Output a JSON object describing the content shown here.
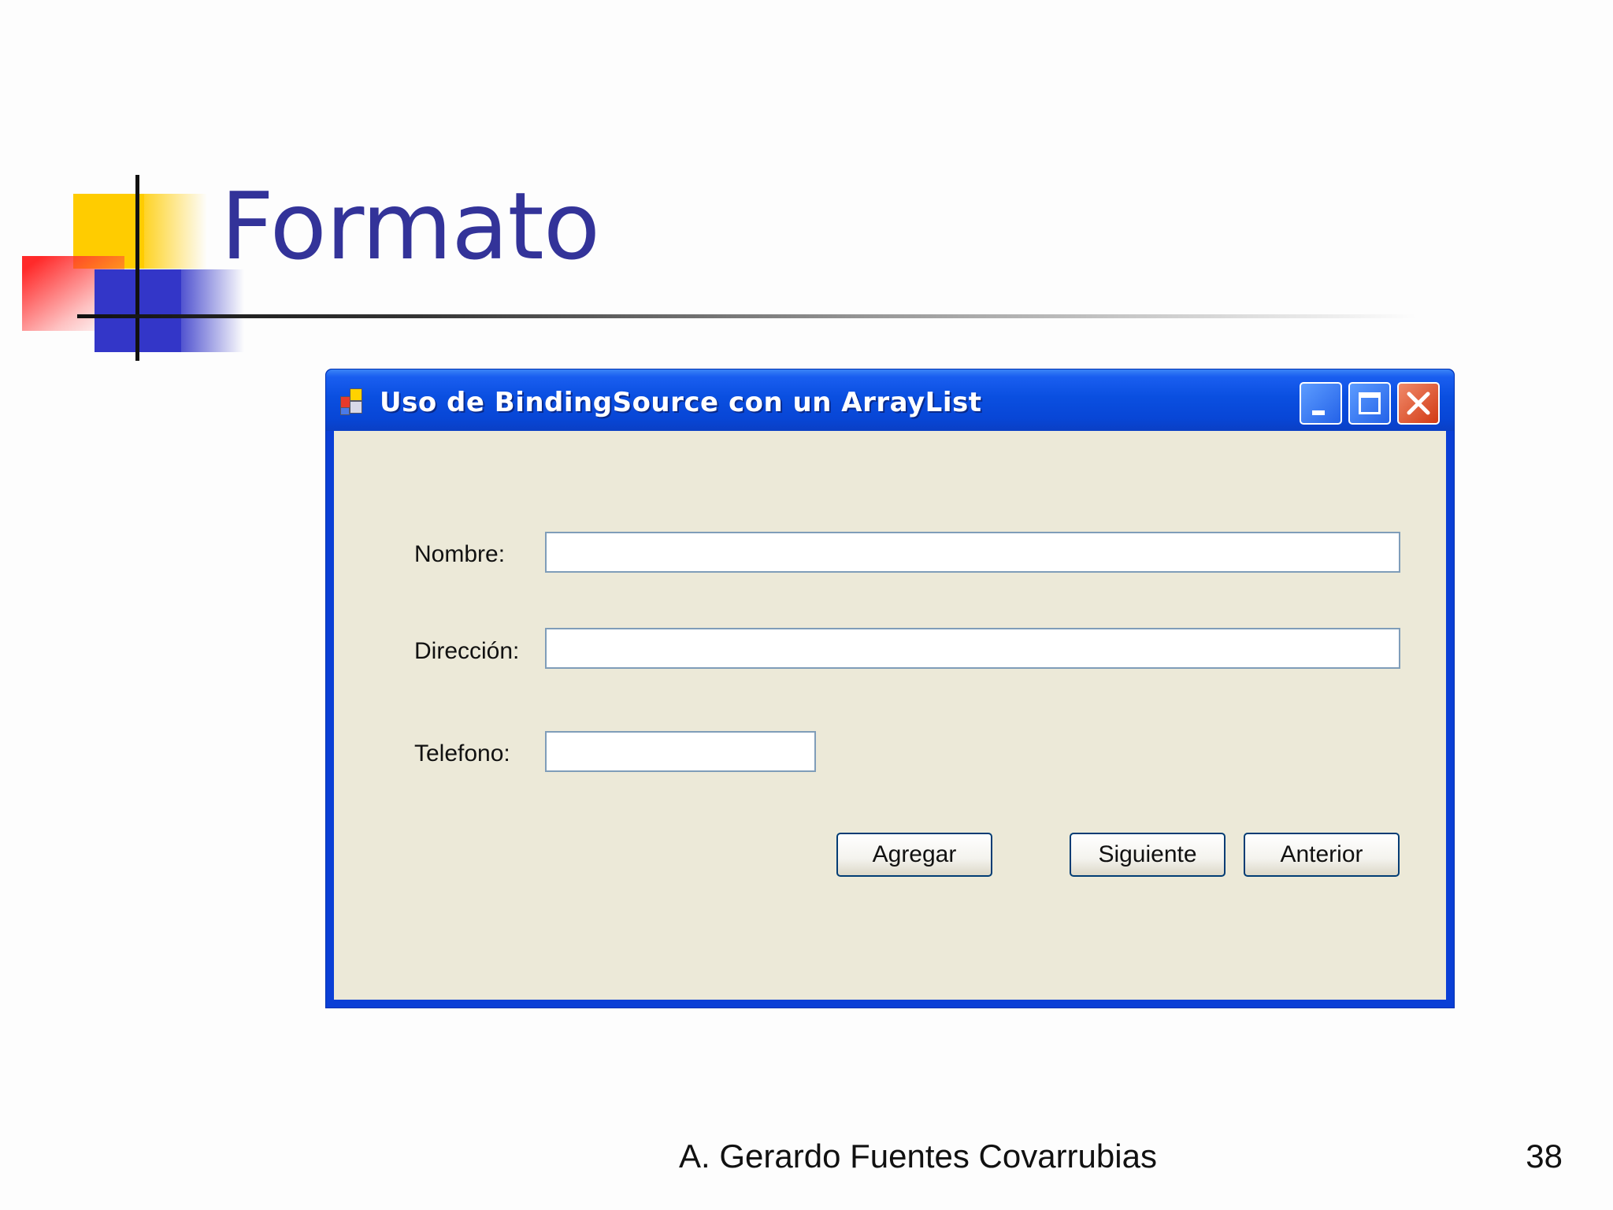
{
  "slide": {
    "title": "Formato",
    "author": "A. Gerardo Fuentes Covarrubias",
    "page_number": "38",
    "title_color": "#333399"
  },
  "window": {
    "title": "Uso de BindingSource con un ArrayList",
    "icon": "application-icon",
    "controls": [
      "minimize-icon",
      "maximize-icon",
      "close-icon"
    ],
    "titlebar_color": "#0a4fe0",
    "client_background": "#ece9d8"
  },
  "form": {
    "nombre": {
      "label": "Nombre:",
      "value": ""
    },
    "direccion": {
      "label": "Dirección:",
      "value": ""
    },
    "telefono": {
      "label": "Telefono:",
      "value": ""
    },
    "buttons": {
      "agregar": "Agregar",
      "siguiente": "Siguiente",
      "anterior": "Anterior"
    }
  }
}
